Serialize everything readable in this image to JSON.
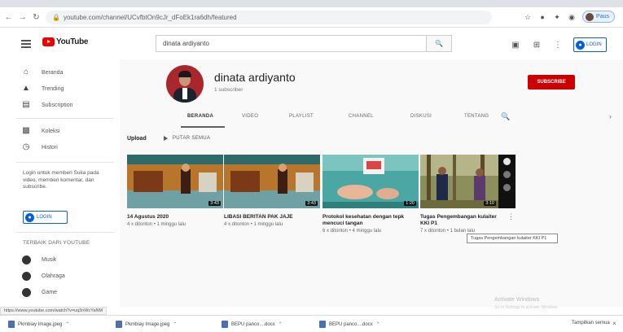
{
  "browser": {
    "url": "youtube.com/channel/UCvfbtOn9cJr_dFoEk1ra6dh/featured",
    "profile_label": "Paus"
  },
  "masthead": {
    "logo_text": "YouTube",
    "search_value": "dinata ardiyanto",
    "login_label": "LOGIN"
  },
  "sidebar": {
    "items": [
      {
        "label": "Beranda"
      },
      {
        "label": "Trending"
      },
      {
        "label": "Subscription"
      },
      {
        "label": "Koleksi"
      },
      {
        "label": "Histori"
      }
    ],
    "login_prompt": "Login untuk memberi Suka pada video, memberi komentar, dan subscribe.",
    "login_button": "LOGIN",
    "section_title": "TERBAIK DARI YOUTUBE",
    "best_items": [
      {
        "label": "Musik"
      },
      {
        "label": "Olahraga"
      },
      {
        "label": "Game"
      }
    ]
  },
  "channel": {
    "name": "dinata ardiyanto",
    "subscribers": "1 subscriber",
    "subscribe_label": "SUBSCRIBE",
    "tabs": [
      "BERANDA",
      "VIDEO",
      "PLAYLIST",
      "CHANNEL",
      "DISKUSI",
      "TENTANG"
    ],
    "active_tab": "BERANDA"
  },
  "uploads": {
    "title": "Upload",
    "play_all": "PUTAR SEMUA",
    "videos": [
      {
        "title": "14 Agustus 2020",
        "meta": "4 x ditonton • 1 minggu lalu",
        "duration": "3:43"
      },
      {
        "title": "LIBASI BERITAN PAK JAJE",
        "meta": "4 x ditonton • 1 minggu lalu",
        "duration": "3:43"
      },
      {
        "title": "Protokol kesehatan dengan tepk mencuci tangan",
        "meta": "6 x ditonton • 4 minggu lalu",
        "duration": "1:20"
      },
      {
        "title": "Tugas Pengembangan kulaiter KKI P1",
        "meta": "7 x ditonton • 1 bulan lalu",
        "duration": "3:10"
      }
    ],
    "tooltip": "Tugas Pengembangan kulaiter KKI P1"
  },
  "watermark": {
    "line1": "Activate Windows",
    "line2": "Go to Settings to activate Windows."
  },
  "status_url": "https://www.youtube.com/watch?v=uq3nWcYaNM",
  "downloads": {
    "items": [
      {
        "label": "Pkmbiay Image.jpeg"
      },
      {
        "label": "Pkmbiay Image.jpeg"
      },
      {
        "label": "BEPU panco....docx"
      },
      {
        "label": "BEPU panco....docx"
      }
    ],
    "show_all": "Tampilkan semua"
  },
  "colors": {
    "brand_red": "#cc0000",
    "link_blue": "#065fd4",
    "content_bg": "#f9f9f9"
  }
}
